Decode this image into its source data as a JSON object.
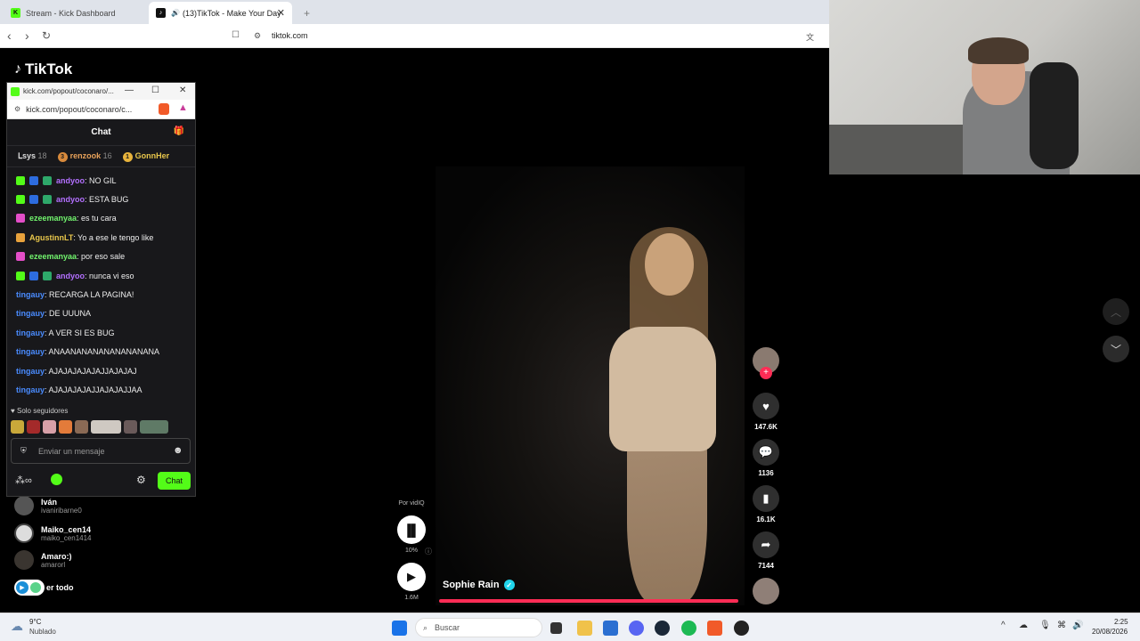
{
  "browser": {
    "tabs": [
      {
        "title": "Stream - Kick Dashboard",
        "favicon": "K"
      },
      {
        "title": "(13)TikTok - Make Your Day",
        "favicon": "tiktok"
      }
    ],
    "new_tab": "+",
    "url": "tiktok.com"
  },
  "tiktok": {
    "logo": "TikTok",
    "video": {
      "author": "Sophie Rain",
      "likes": "147.6K",
      "comments": "1136",
      "saves": "16.1K",
      "shares": "7144"
    },
    "vidiq": {
      "label": "Por vidIQ",
      "percent": "10%",
      "views": "1.6M"
    },
    "following": [
      {
        "name": "Iván",
        "handle": "ivaniribarne0"
      },
      {
        "name": "Maiko_cen14",
        "handle": "maiko_cen1414"
      },
      {
        "name": "Amaro:)",
        "handle": "amarorl"
      }
    ],
    "see_all": "er todo"
  },
  "popup": {
    "title": "kick.com/popout/coconaro/...",
    "url": "kick.com/popout/coconaro/c...",
    "chat_title": "Chat",
    "leaders": [
      {
        "name": "ꓡsys",
        "count": "18"
      },
      {
        "name": "renzook",
        "count": "16",
        "rank": "3"
      },
      {
        "name": "GonnHer",
        "rank": "1"
      }
    ],
    "messages": [
      {
        "user": "andyoo",
        "text": ": NO GIL",
        "color": "#b370ff"
      },
      {
        "user": "andyoo",
        "text": ": ESTA BUG",
        "color": "#b370ff"
      },
      {
        "user": "ezeemanyaa",
        "text": ": es tu cara",
        "color": "#72f56e"
      },
      {
        "user": "AgustinnLT",
        "text": ": Yo a ese le tengo like",
        "color": "#e8c64b"
      },
      {
        "user": "ezeemanyaa",
        "text": ": por eso sale",
        "color": "#72f56e"
      },
      {
        "user": "andyoo",
        "text": ": nunca vi eso",
        "color": "#b370ff"
      },
      {
        "user": "tingauy",
        "text": ": RECARGA LA PAGINA!",
        "color": "#4a8cff"
      },
      {
        "user": "tingauy",
        "text": ": DE UUUNA",
        "color": "#4a8cff"
      },
      {
        "user": "tingauy",
        "text": ": A VER SI ES BUG",
        "color": "#4a8cff"
      },
      {
        "user": "tingauy",
        "text": ": ANAANANANANANANANANA",
        "color": "#4a8cff"
      },
      {
        "user": "tingauy",
        "text": ": AJAJAJAJAJAJJAJAJAJ",
        "color": "#4a8cff"
      },
      {
        "user": "tingauy",
        "text": ": AJAJAJAJAJJAJAJAJJAA",
        "color": "#4a8cff"
      }
    ],
    "followers_only": "Solo seguidores",
    "input_placeholder": "Enviar un mensaje",
    "send": "Chat"
  },
  "taskbar": {
    "weather_temp": "9°C",
    "weather_desc": "Nublado",
    "search": "Buscar",
    "time": "2:25",
    "date": "20/08/2026"
  }
}
